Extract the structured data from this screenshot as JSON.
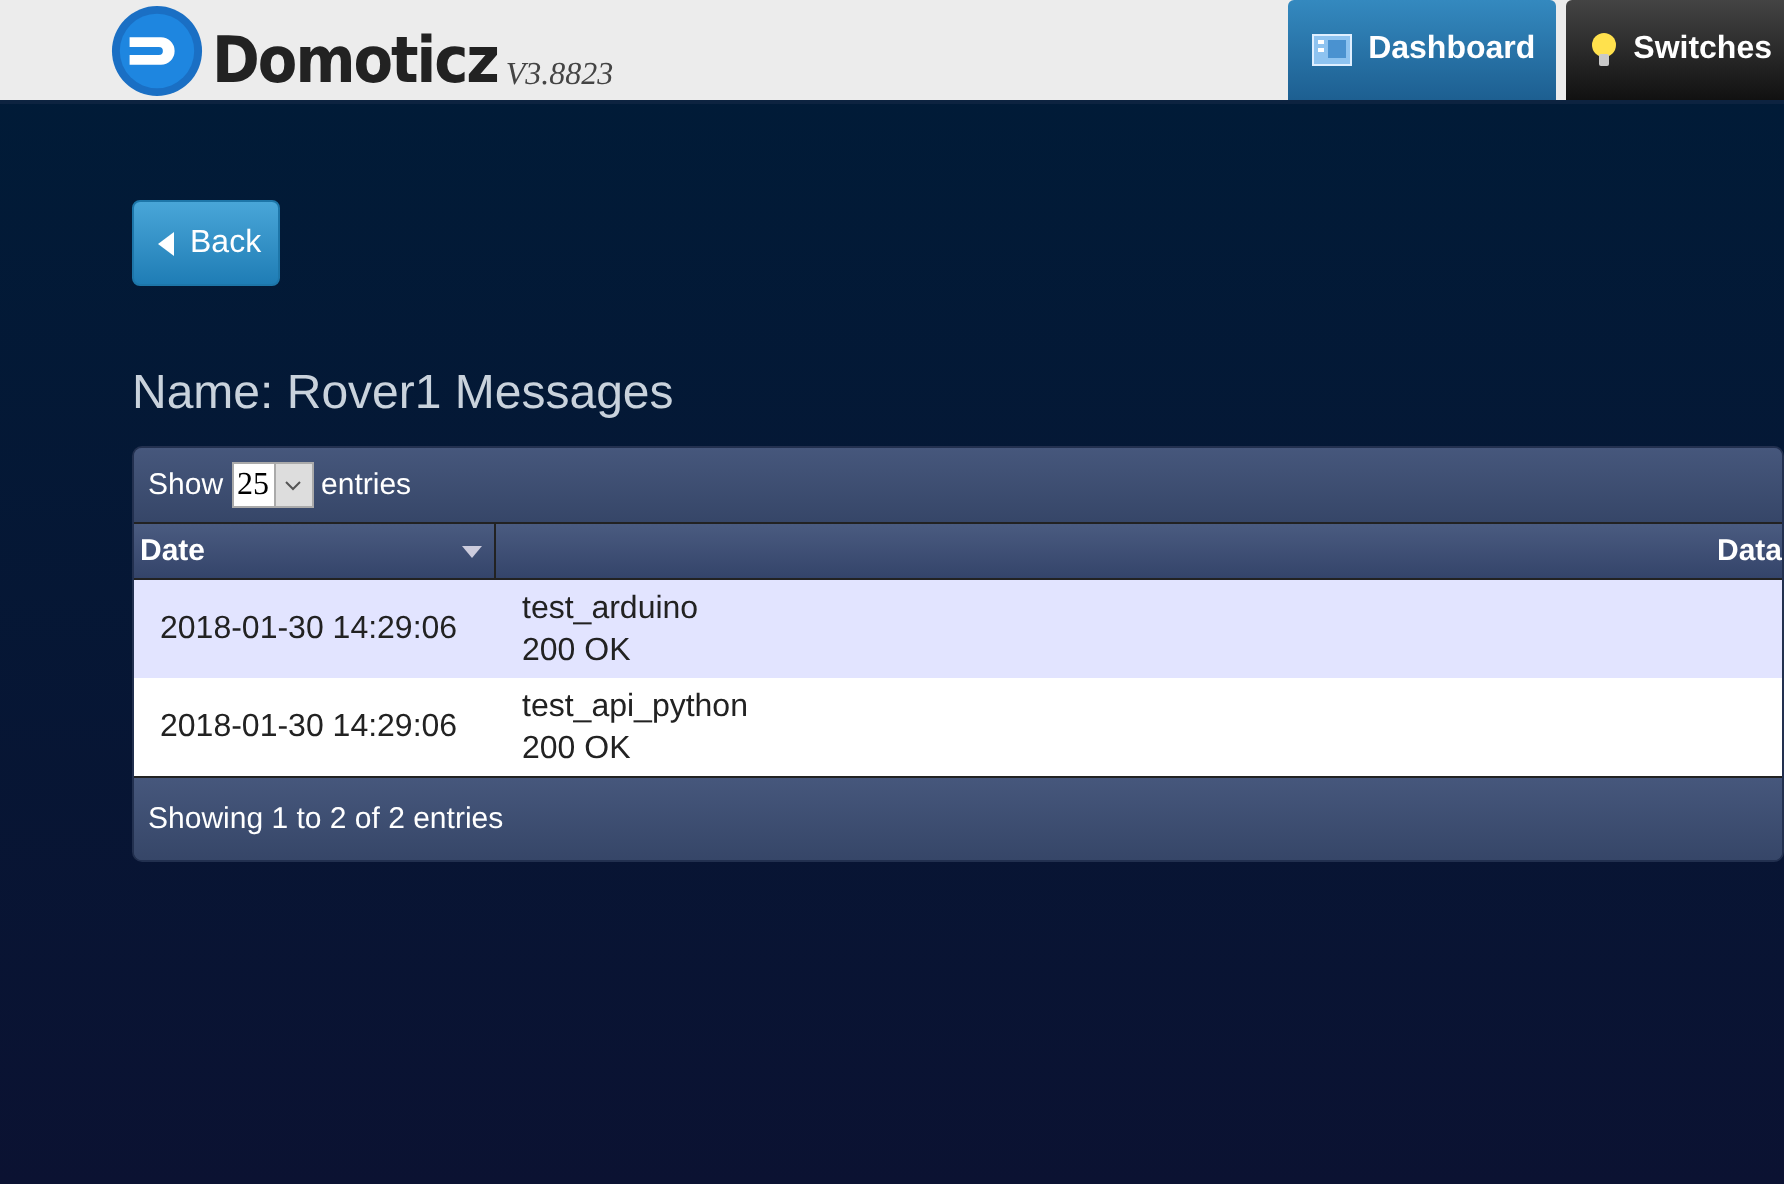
{
  "header": {
    "logo": "Domoticz",
    "version": "V3.8823",
    "nav": [
      {
        "label": "Dashboard",
        "kind": "dashboard",
        "selected": true
      },
      {
        "label": "Switches",
        "kind": "bulb",
        "selected": false
      }
    ]
  },
  "back_button": "Back",
  "title": "Name: Rover1 Messages",
  "table": {
    "length": {
      "before": "Show",
      "value": "25",
      "after": "entries"
    },
    "columns": [
      {
        "label": "Date",
        "sorted": true
      },
      {
        "label": "Data",
        "sorted": false
      }
    ],
    "rows": [
      {
        "date": "2018-01-30 14:29:06",
        "data": [
          "test_arduino",
          "200 OK"
        ]
      },
      {
        "date": "2018-01-30 14:29:06",
        "data": [
          "test_api_python",
          "200 OK"
        ]
      }
    ],
    "info": "Showing 1 to 2 of 2 entries"
  }
}
